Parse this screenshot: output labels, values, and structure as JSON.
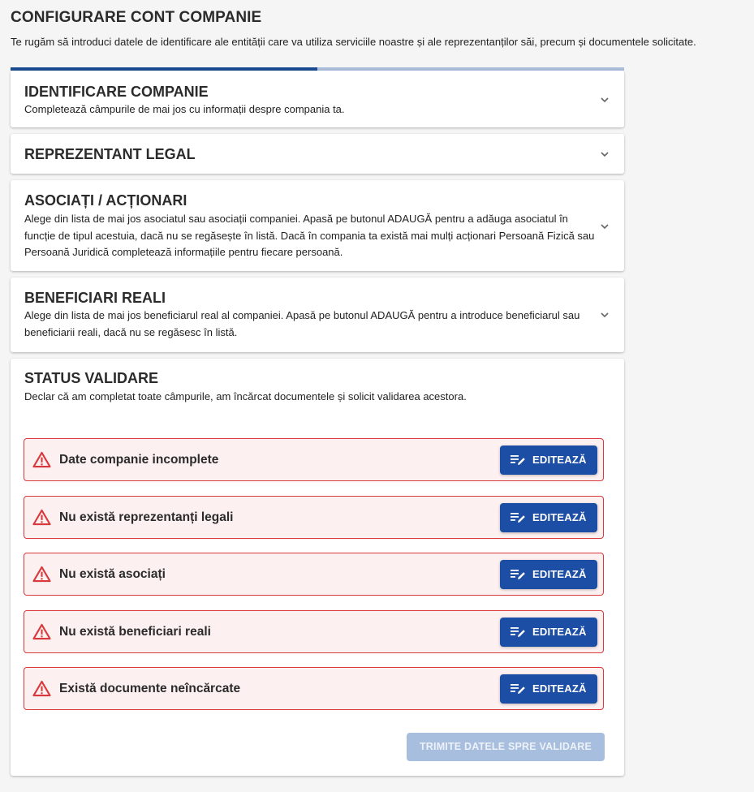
{
  "page": {
    "title": "CONFIGURARE CONT COMPANIE",
    "subtitle": "Te rugăm să introduci datele de identificare ale entității care va utiliza serviciile noastre și ale reprezentanților săi, precum și documentele solicitate."
  },
  "progress": {
    "percent": 50,
    "fill_color": "#1a4a8f",
    "track_color": "#a9bcd9"
  },
  "sections": [
    {
      "title": "IDENTIFICARE COMPANIE",
      "description": "Completează câmpurile de mai jos cu informații despre compania ta.",
      "icon": "chevron-down-icon"
    },
    {
      "title": "REPREZENTANT LEGAL",
      "description": "",
      "icon": "chevron-down-icon"
    },
    {
      "title": "ASOCIAȚI / ACȚIONARI",
      "description": "Alege din lista de mai jos asociatul sau asociații companiei. Apasă pe butonul ADAUGĂ pentru a adăuga asociatul în funcție de tipul acestuia, dacă nu se regăsește în listă. Dacă în compania ta există mai mulți acționari Persoană Fizică sau Persoană Juridică completează informațiile pentru fiecare persoană.",
      "icon": "chevron-down-icon"
    },
    {
      "title": "BENEFICIARI REALI",
      "description": "Alege din lista de mai jos beneficiarul real al companiei. Apasă pe butonul ADAUGĂ pentru a introduce beneficiarul sau beneficiarii reali, dacă nu se regăsesc în listă.",
      "icon": "chevron-down-icon"
    }
  ],
  "validation": {
    "title": "STATUS VALIDARE",
    "description": "Declar că am completat toate câmpurile, am încărcat documentele și solicit validarea acestora.",
    "items": [
      {
        "text": "Date companie incomplete",
        "button": "EDITEAZĂ",
        "icon": "warning-icon"
      },
      {
        "text": "Nu există reprezentanți legali",
        "button": "EDITEAZĂ",
        "icon": "warning-icon"
      },
      {
        "text": "Nu există asociați",
        "button": "EDITEAZĂ",
        "icon": "warning-icon"
      },
      {
        "text": "Nu există beneficiari reali",
        "button": "EDITEAZĂ",
        "icon": "warning-icon"
      },
      {
        "text": "Există documente neîncărcate",
        "button": "EDITEAZĂ",
        "icon": "warning-icon"
      }
    ],
    "submit_label": "TRIMITE DATELE SPRE VALIDARE",
    "colors": {
      "error_border": "#d8393d",
      "error_bg": "#fdf0f0",
      "button": "#1d4ea5",
      "submit_disabled": "#a7bedf"
    }
  }
}
